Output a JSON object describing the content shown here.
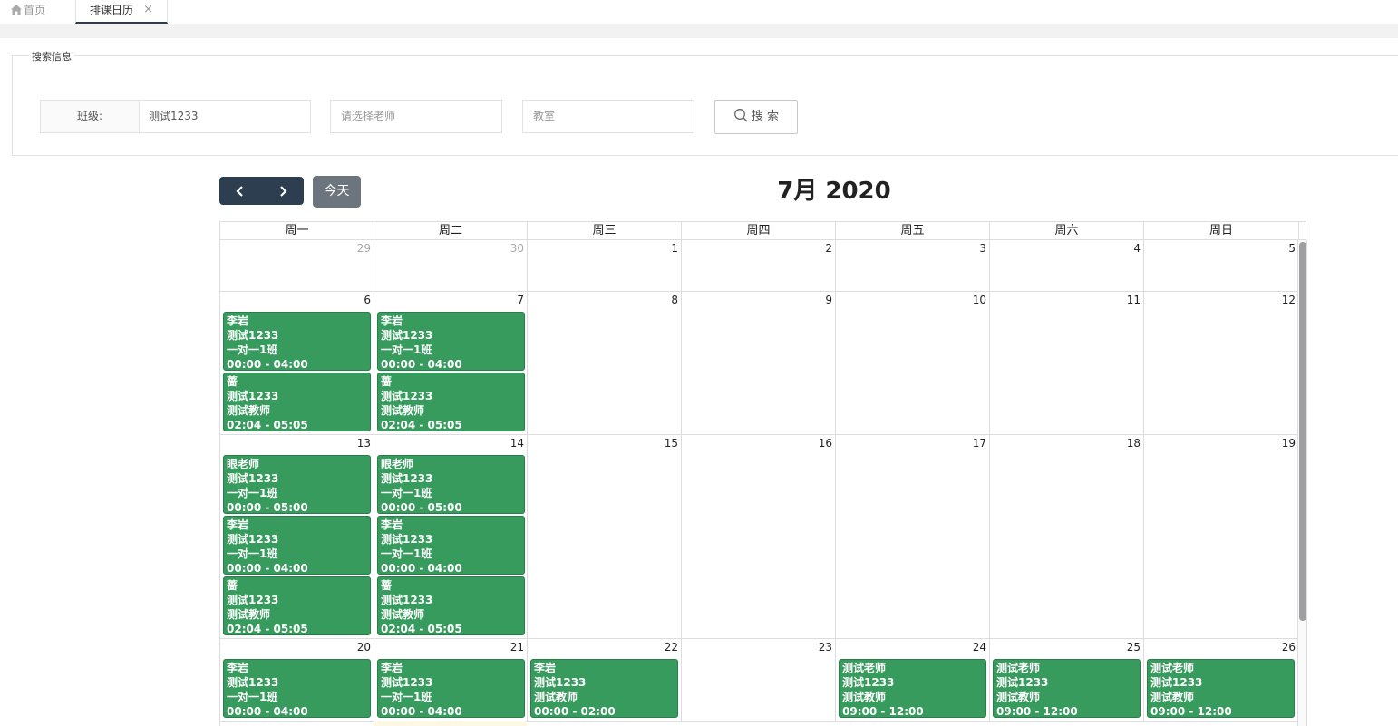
{
  "tabs": {
    "home_label": "首页",
    "active_label": "排课日历",
    "close_glyph": "×"
  },
  "search": {
    "legend": "搜索信息",
    "class_label": "班级:",
    "class_value": "测试1233",
    "teacher_placeholder": "请选择老师",
    "room_placeholder": "教室",
    "search_button": "搜 索"
  },
  "calendar": {
    "today_button": "今天",
    "title": "7月 2020",
    "weekdays": [
      "周一",
      "周二",
      "周三",
      "周四",
      "周五",
      "周六",
      "周日"
    ],
    "accent_color": "#379b5e",
    "weeks": [
      {
        "days": [
          {
            "num": "29",
            "other": true,
            "events": []
          },
          {
            "num": "30",
            "other": true,
            "events": []
          },
          {
            "num": "1",
            "events": []
          },
          {
            "num": "2",
            "events": []
          },
          {
            "num": "3",
            "events": []
          },
          {
            "num": "4",
            "events": []
          },
          {
            "num": "5",
            "events": []
          }
        ]
      },
      {
        "days": [
          {
            "num": "6",
            "events": [
              {
                "teacher": "李岩",
                "class": "测试1233",
                "course": "一对一1班",
                "time": "00:00 - 04:00"
              },
              {
                "teacher": "蔷",
                "class": "测试1233",
                "course": "测试教师",
                "time": "02:04 - 05:05"
              }
            ]
          },
          {
            "num": "7",
            "events": [
              {
                "teacher": "李岩",
                "class": "测试1233",
                "course": "一对一1班",
                "time": "00:00 - 04:00"
              },
              {
                "teacher": "蔷",
                "class": "测试1233",
                "course": "测试教师",
                "time": "02:04 - 05:05"
              }
            ]
          },
          {
            "num": "8",
            "events": []
          },
          {
            "num": "9",
            "events": []
          },
          {
            "num": "10",
            "events": []
          },
          {
            "num": "11",
            "events": []
          },
          {
            "num": "12",
            "events": []
          }
        ]
      },
      {
        "days": [
          {
            "num": "13",
            "events": [
              {
                "teacher": "眼老师",
                "class": "测试1233",
                "course": "一对一1班",
                "time": "00:00 - 05:00"
              },
              {
                "teacher": "李岩",
                "class": "测试1233",
                "course": "一对一1班",
                "time": "00:00 - 04:00"
              },
              {
                "teacher": "蔷",
                "class": "测试1233",
                "course": "测试教师",
                "time": "02:04 - 05:05"
              }
            ]
          },
          {
            "num": "14",
            "events": [
              {
                "teacher": "眼老师",
                "class": "测试1233",
                "course": "一对一1班",
                "time": "00:00 - 05:00"
              },
              {
                "teacher": "李岩",
                "class": "测试1233",
                "course": "一对一1班",
                "time": "00:00 - 04:00"
              },
              {
                "teacher": "蔷",
                "class": "测试1233",
                "course": "测试教师",
                "time": "02:04 - 05:05"
              }
            ]
          },
          {
            "num": "15",
            "events": []
          },
          {
            "num": "16",
            "events": []
          },
          {
            "num": "17",
            "events": []
          },
          {
            "num": "18",
            "events": []
          },
          {
            "num": "19",
            "events": []
          }
        ]
      },
      {
        "days": [
          {
            "num": "20",
            "events": [
              {
                "teacher": "李岩",
                "class": "测试1233",
                "course": "一对一1班",
                "time": "00:00 - 04:00"
              }
            ]
          },
          {
            "num": "21",
            "events": [
              {
                "teacher": "李岩",
                "class": "测试1233",
                "course": "一对一1班",
                "time": "00:00 - 04:00"
              }
            ]
          },
          {
            "num": "22",
            "events": [
              {
                "teacher": "李岩",
                "class": "测试1233",
                "course": "测试教师",
                "time": "00:00 - 02:00"
              }
            ]
          },
          {
            "num": "23",
            "events": []
          },
          {
            "num": "24",
            "events": [
              {
                "teacher": "测试老师",
                "class": "测试1233",
                "course": "测试教师",
                "time": "09:00 - 12:00"
              }
            ]
          },
          {
            "num": "25",
            "events": [
              {
                "teacher": "测试老师",
                "class": "测试1233",
                "course": "测试教师",
                "time": "09:00 - 12:00"
              }
            ]
          },
          {
            "num": "26",
            "events": [
              {
                "teacher": "测试老师",
                "class": "测试1233",
                "course": "测试教师",
                "time": "09:00 - 12:00"
              }
            ]
          }
        ]
      }
    ]
  }
}
